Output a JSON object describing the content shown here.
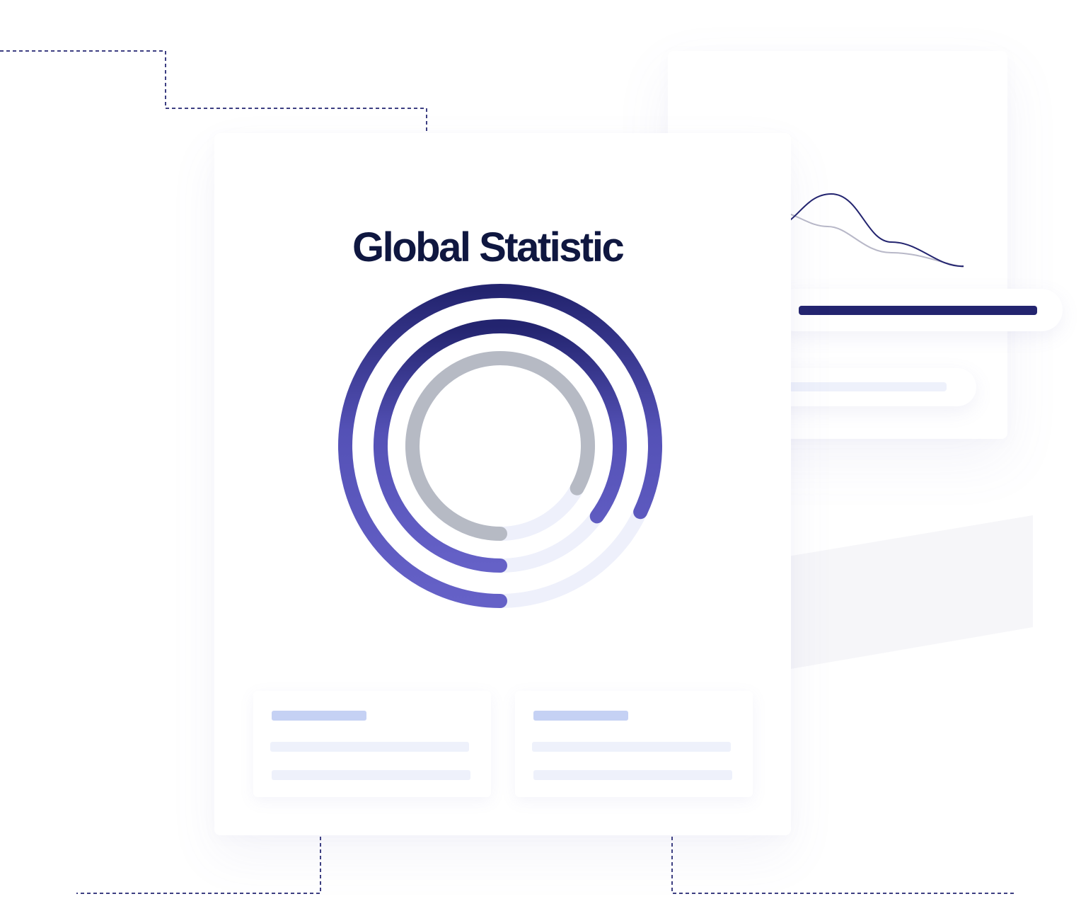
{
  "title": "Global Statistic",
  "colors": {
    "title": "#0f1740",
    "navy": "#23246f",
    "indigo": "#5f5cc0",
    "gray_ring": "#b6bac4",
    "track": "#eef0fb",
    "connector": "#3d3f82",
    "placeholder_blue": "#c5d1f4",
    "placeholder_light": "#eef1fb"
  },
  "rings": [
    {
      "name": "outer",
      "fill_fraction": 0.82
    },
    {
      "name": "middle",
      "fill_fraction": 0.85
    },
    {
      "name": "inner",
      "fill_fraction": 0.83
    }
  ],
  "wave_chart": {
    "series": [
      {
        "color": "#b8b8c8",
        "values": [
          0,
          0.76,
          0.75,
          0.55,
          0.45,
          0.0
        ]
      },
      {
        "color": "#23246f",
        "values": [
          0,
          0.55,
          1.0,
          0.48,
          0.28,
          0.05
        ]
      }
    ]
  },
  "progress_pills": [
    {
      "fill_fraction": 1.0,
      "color": "#23246f"
    },
    {
      "fill_fraction": 1.0,
      "color": "#eef1fb"
    }
  ],
  "stat_cards": [
    {
      "name": "left"
    },
    {
      "name": "right"
    }
  ]
}
